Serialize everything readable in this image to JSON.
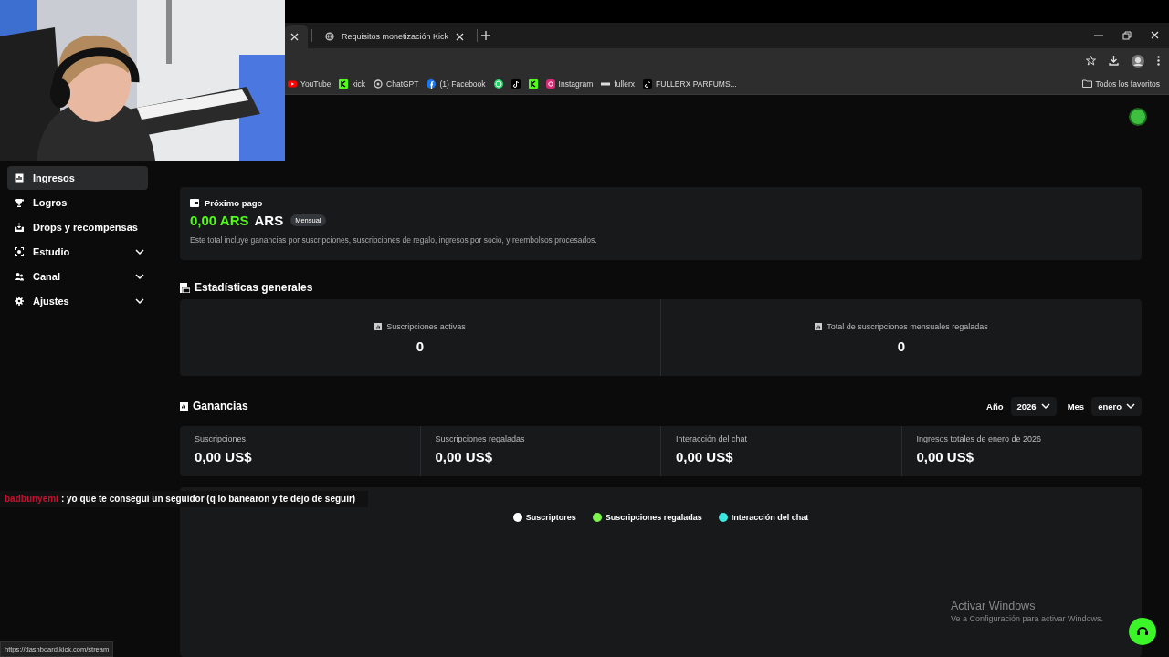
{
  "browser": {
    "tabs": [
      {
        "selected": true
      },
      {
        "title": "Requisitos monetización Kick",
        "selected": false
      }
    ],
    "bookmarks": [
      {
        "kind": "youtube",
        "label": "YouTube"
      },
      {
        "kind": "kick",
        "label": "kick"
      },
      {
        "kind": "chatgpt",
        "label": "ChatGPT"
      },
      {
        "kind": "facebook",
        "label": "(1) Facebook"
      },
      {
        "kind": "whatsapp"
      },
      {
        "kind": "tiktok"
      },
      {
        "kind": "kick"
      },
      {
        "kind": "instagram",
        "label": "Instagram"
      },
      {
        "kind": "fullerx",
        "label": "fullerx"
      },
      {
        "kind": "tiktok",
        "label": "FULLERX PARFUMS..."
      }
    ],
    "all_bookmarks": "Todos los favoritos",
    "status_url": "https://dashboard.kick.com/stream"
  },
  "sidebar": {
    "items": [
      {
        "kind": "link",
        "label": "Ingresos",
        "selected": true
      },
      {
        "kind": "link",
        "label": "Logros",
        "selected": false
      },
      {
        "kind": "link",
        "label": "Drops y recompensas",
        "selected": false
      },
      {
        "kind": "group",
        "label": "Estudio",
        "selected": false
      },
      {
        "kind": "group",
        "label": "Canal",
        "selected": false
      },
      {
        "kind": "group",
        "label": "Ajustes",
        "selected": false
      }
    ]
  },
  "payout": {
    "title": "Próximo pago",
    "amount": "0,00 ARS",
    "currency": "ARS",
    "badge": "Mensual",
    "note": "Este total incluye ganancias por suscripciones, suscripciones de regalo, ingresos por socio, y reembolsos procesados."
  },
  "stats": {
    "title": "Estadísticas generales",
    "cards": [
      {
        "label": "Suscripciones activas",
        "value": "0"
      },
      {
        "label": "Total de suscripciones mensuales regaladas",
        "value": "0"
      }
    ]
  },
  "earnings": {
    "title": "Ganancias",
    "filters": [
      {
        "label": "Año",
        "value": "2026"
      },
      {
        "label": "Mes",
        "value": "enero"
      }
    ],
    "cards": [
      {
        "label": "Suscripciones",
        "value": "0,00 US$"
      },
      {
        "label": "Suscripciones regaladas",
        "value": "0,00 US$"
      },
      {
        "label": "Interacción del chat",
        "value": "0,00 US$"
      },
      {
        "label": "Ingresos totales de enero de 2026",
        "value": "0,00 US$"
      }
    ],
    "legend": [
      {
        "label": "Suscriptores",
        "color": "#ffffff"
      },
      {
        "label": "Suscripciones regaladas",
        "color": "#7ef54f"
      },
      {
        "label": "Interacción del chat",
        "color": "#3ee6e0"
      }
    ]
  },
  "chat_overlay": {
    "user": "badbunyemi",
    "message": ": yo que te conseguí un seguidor (q lo banearon y te dejo de seguir)"
  },
  "windows_notice": {
    "title": "Activar Windows",
    "text": "Ve a Configuración para activar Windows."
  }
}
